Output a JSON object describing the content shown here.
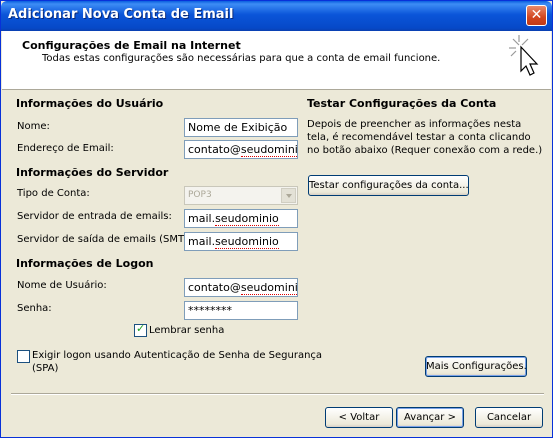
{
  "window": {
    "title": "Adicionar Nova Conta de Email",
    "close_label": "✕"
  },
  "header": {
    "title": "Configurações de Email na Internet",
    "subtitle": "Todas estas configurações são necessárias para que a conta de email funcione."
  },
  "user_info": {
    "section_title": "Informações do Usuário",
    "name_label": "Nome:",
    "name_value": "Nome de Exibição",
    "email_label": "Endereço de Email:",
    "email_prefix": "contato@",
    "email_domain": "seudominio"
  },
  "server_info": {
    "section_title": "Informações do Servidor",
    "account_type_label": "Tipo de Conta:",
    "account_type_value": "POP3",
    "incoming_label": "Servidor de entrada de emails:",
    "incoming_prefix": "mail.",
    "incoming_domain": "seudominio",
    "outgoing_label": "Servidor de saída de emails (SMTP):",
    "outgoing_prefix": "mail.",
    "outgoing_domain": "seudominio"
  },
  "logon_info": {
    "section_title": "Informações de Logon",
    "username_label": "Nome de Usuário:",
    "username_prefix": "contato@",
    "username_domain": "seudominio",
    "password_label": "Senha:",
    "password_value": "********",
    "remember_label": "Lembrar senha",
    "remember_checked": true,
    "spa_label_line1": "Exigir logon usando Autenticação de Senha de Segurança",
    "spa_label_line2": "(SPA)",
    "spa_checked": false
  },
  "test_settings": {
    "section_title": "Testar Configurações da Conta",
    "description": "Depois de preencher as informações nesta tela, é recomendável testar a conta clicando no botão abaixo (Requer conexão com a rede.)",
    "test_button": "Testar configurações da conta..."
  },
  "buttons": {
    "more_settings": "Mais Configurações.",
    "back": "< Voltar",
    "next": "Avançar >",
    "cancel": "Cancelar"
  }
}
